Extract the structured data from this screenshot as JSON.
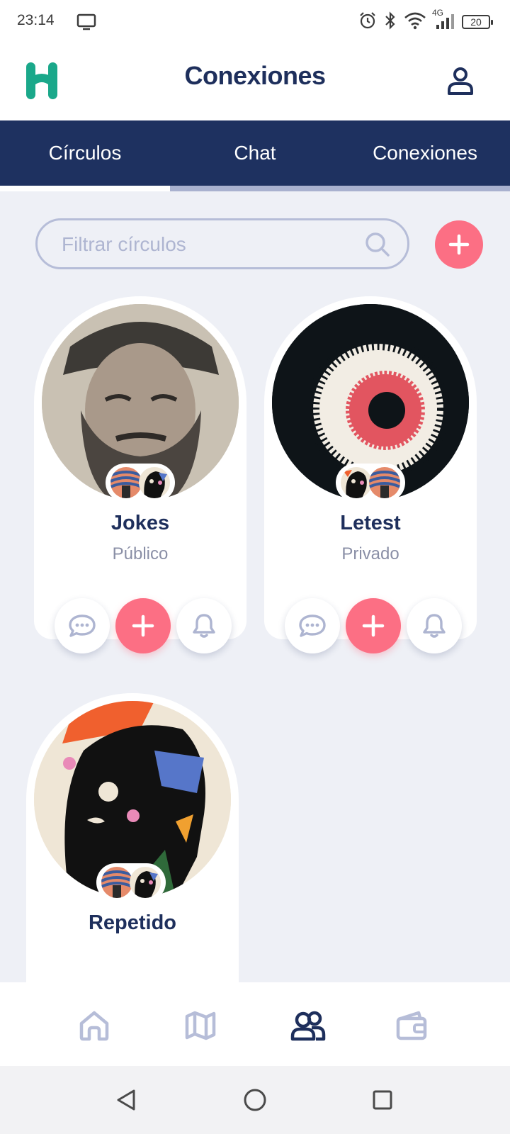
{
  "status_bar": {
    "time": "23:14",
    "network": "4G",
    "battery": "20"
  },
  "header": {
    "title": "Conexiones",
    "logo_icon": "h-logo-icon",
    "profile_icon": "user-icon"
  },
  "tabs": [
    {
      "label": "Círculos",
      "active": true
    },
    {
      "label": "Chat",
      "active": false
    },
    {
      "label": "Conexiones",
      "active": false
    }
  ],
  "search": {
    "placeholder": "Filtrar círculos"
  },
  "circles": [
    {
      "name": "Jokes",
      "visibility": "Público"
    },
    {
      "name": "Letest",
      "visibility": "Privado"
    },
    {
      "name": "Repetido",
      "visibility": ""
    }
  ],
  "bottom_nav": [
    {
      "icon": "home-icon",
      "active": false
    },
    {
      "icon": "map-icon",
      "active": false
    },
    {
      "icon": "users-icon",
      "active": true
    },
    {
      "icon": "wallet-icon",
      "active": false
    }
  ],
  "colors": {
    "primary": "#1e3160",
    "accent": "#fc6f84",
    "logo": "#1aa88a",
    "background": "#eef0f6",
    "muted": "#b6bdd8"
  }
}
